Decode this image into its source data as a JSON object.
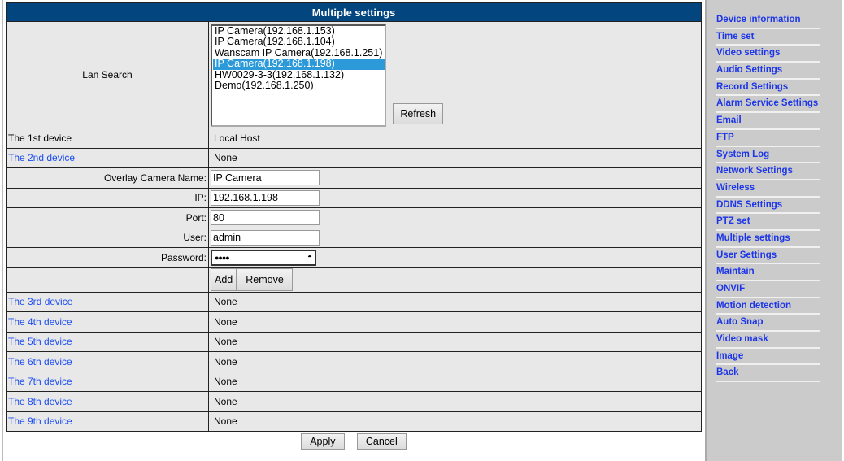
{
  "title": "Multiple settings",
  "lan_search": {
    "label": "Lan Search",
    "options": [
      "IP Camera(192.168.1.153)",
      "IP Camera(192.168.1.104)",
      "Wanscam IP Camera(192.168.1.251)",
      "IP Camera(192.168.1.198)",
      "HW0029-3-3(192.168.1.132)",
      "Demo(192.168.1.250)"
    ],
    "selected": "IP Camera(192.168.1.198)",
    "refresh": "Refresh"
  },
  "first_device": {
    "label": "The 1st device",
    "value": "Local Host"
  },
  "second_device": {
    "label": "The 2nd device",
    "value": "None"
  },
  "form": {
    "name_label": "Overlay Camera Name:",
    "name_value": "IP Camera",
    "ip_label": "IP:",
    "ip_value": "192.168.1.198",
    "port_label": "Port:",
    "port_value": "80",
    "user_label": "User:",
    "user_value": "admin",
    "password_label": "Password:",
    "password_mask": "●●●●",
    "add": "Add",
    "remove": "Remove"
  },
  "devices": [
    {
      "label": "The 3rd device",
      "value": "None"
    },
    {
      "label": "The 4th device",
      "value": "None"
    },
    {
      "label": "The 5th device",
      "value": "None"
    },
    {
      "label": "The 6th device",
      "value": "None"
    },
    {
      "label": "The 7th device",
      "value": "None"
    },
    {
      "label": "The 8th device",
      "value": "None"
    },
    {
      "label": "The 9th device",
      "value": "None"
    }
  ],
  "actions": {
    "apply": "Apply",
    "cancel": "Cancel"
  },
  "sidebar": [
    "Device information",
    "Time set",
    "Video settings",
    "Audio Settings",
    "Record Settings",
    "Alarm Service Settings",
    "Email",
    "FTP",
    "System Log",
    "Network Settings",
    "Wireless",
    "DDNS Settings",
    "PTZ set",
    "Multiple settings",
    "User Settings",
    "Maintain",
    "ONVIF",
    "Motion detection",
    "Auto Snap",
    "Video mask",
    "Image",
    "Back"
  ],
  "colors": {
    "header": "#03467f",
    "link": "#1c4ef0",
    "selected": "#2c9ad8",
    "sidebar_bg": "#cbcbcb"
  }
}
